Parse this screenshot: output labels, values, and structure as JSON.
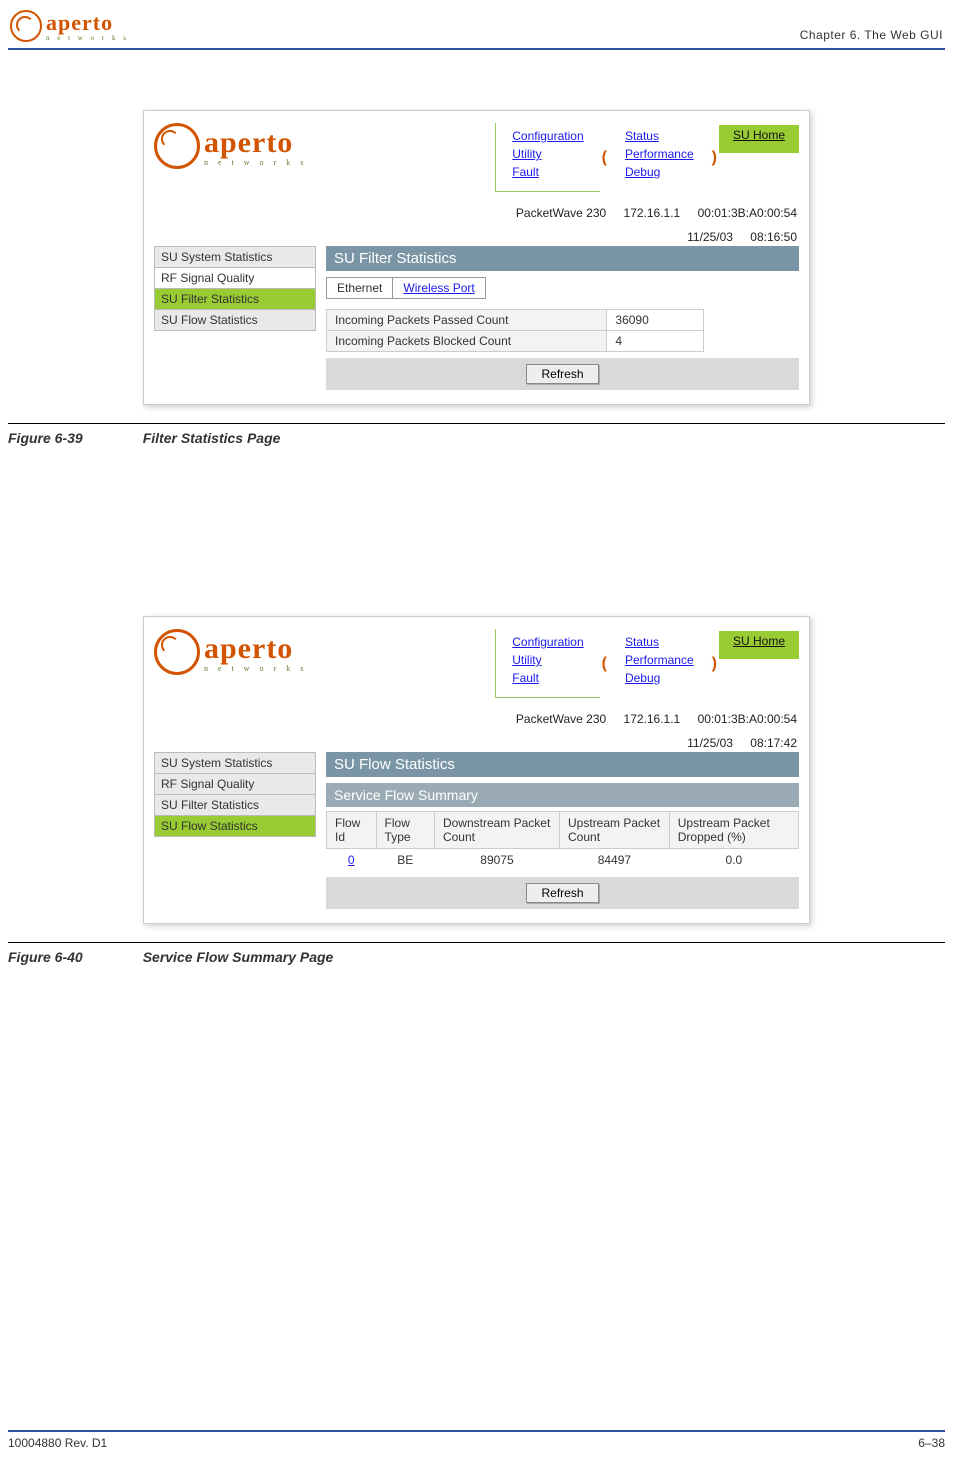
{
  "page_header": {
    "logo_main": "aperto",
    "logo_sub": "n e t w o r k s",
    "chapter": "Chapter 6.  The Web GUI"
  },
  "page_footer": {
    "rev": "10004880 Rev. D1",
    "page_num": "6–38"
  },
  "figure1": {
    "num": "Figure 6-39",
    "title": "Filter Statistics Page"
  },
  "figure2": {
    "num": "Figure 6-40",
    "title": "Service Flow Summary Page"
  },
  "shot1": {
    "logo_main": "aperto",
    "logo_sub": "n e t w o r k s",
    "menu": {
      "col1": [
        "Configuration",
        "Utility",
        "Fault"
      ],
      "col2": [
        "Status",
        "Performance",
        "Debug"
      ],
      "home": "SU Home"
    },
    "info1": {
      "device": "PacketWave 230",
      "ip": "172.16.1.1",
      "mac": "00:01:3B:A0:00:54"
    },
    "info2": {
      "date": "11/25/03",
      "time": "08:16:50"
    },
    "sidebar": [
      {
        "label": "SU System Statistics",
        "active": false,
        "shade": true
      },
      {
        "label": "RF Signal Quality",
        "active": false,
        "shade": false
      },
      {
        "label": "SU Filter Statistics",
        "active": true,
        "shade": false
      },
      {
        "label": "SU Flow Statistics",
        "active": false,
        "shade": true
      }
    ],
    "content_title": "SU Filter Statistics",
    "tabs": [
      {
        "label": "Ethernet",
        "active": true
      },
      {
        "label": "Wireless Port",
        "link": true
      }
    ],
    "rows": [
      {
        "label": "Incoming Packets Passed Count",
        "value": "36090"
      },
      {
        "label": "Incoming Packets Blocked Count",
        "value": "4"
      }
    ],
    "refresh": "Refresh"
  },
  "shot2": {
    "logo_main": "aperto",
    "logo_sub": "n e t w o r k s",
    "menu": {
      "col1": [
        "Configuration",
        "Utility",
        "Fault"
      ],
      "col2": [
        "Status",
        "Performance",
        "Debug"
      ],
      "home": "SU Home"
    },
    "info1": {
      "device": "PacketWave 230",
      "ip": "172.16.1.1",
      "mac": "00:01:3B:A0:00:54"
    },
    "info2": {
      "date": "11/25/03",
      "time": "08:17:42"
    },
    "sidebar": [
      {
        "label": "SU System Statistics",
        "active": false,
        "shade": true
      },
      {
        "label": "RF Signal Quality",
        "active": false,
        "shade": true
      },
      {
        "label": "SU Filter Statistics",
        "active": false,
        "shade": true
      },
      {
        "label": "SU Flow Statistics",
        "active": true,
        "shade": false
      }
    ],
    "content_title": "SU Flow Statistics",
    "sub_title": "Service Flow Summary",
    "columns": [
      "Flow Id",
      "Flow Type",
      "Downstream Packet Count",
      "Upstream Packet Count",
      "Upstream Packet Dropped (%)"
    ],
    "row": {
      "id": "0",
      "type": "BE",
      "down": "89075",
      "up": "84497",
      "drop": "0.0"
    },
    "refresh": "Refresh"
  }
}
